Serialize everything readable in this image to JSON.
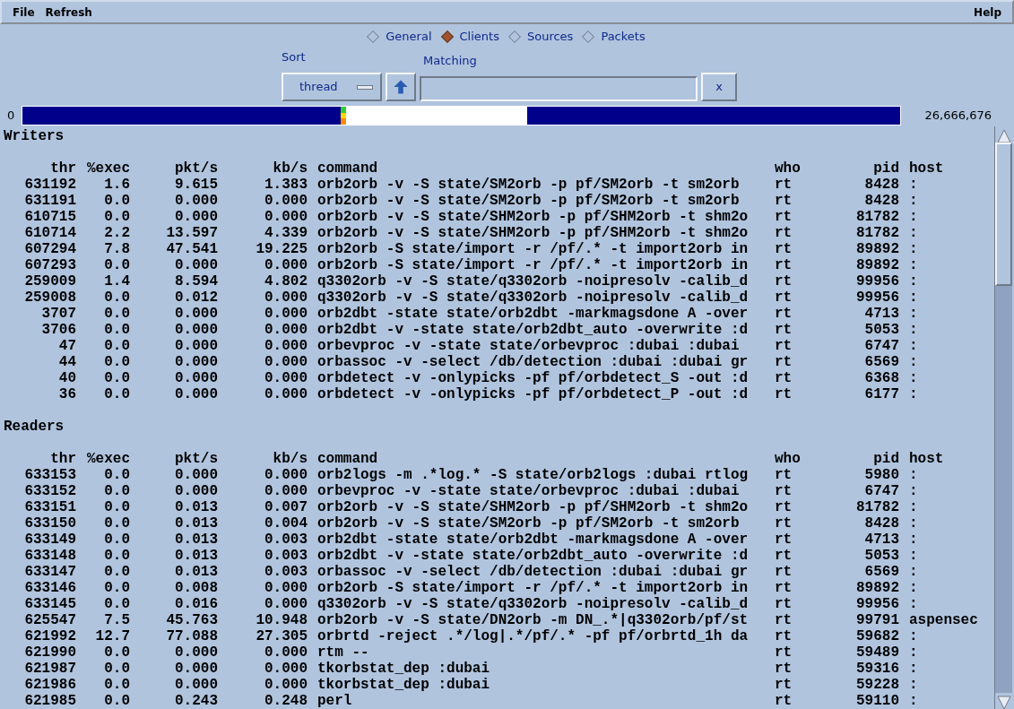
{
  "menu": [
    "File",
    "Refresh"
  ],
  "help_menu": "Help",
  "tabs": [
    {
      "label": "General",
      "selected": false
    },
    {
      "label": "Clients",
      "selected": true
    },
    {
      "label": "Sources",
      "selected": false
    },
    {
      "label": "Packets",
      "selected": false
    }
  ],
  "sort": {
    "label": "Sort",
    "value": "thread"
  },
  "matching": {
    "label": "Matching"
  },
  "clear_button": "x",
  "buffer": {
    "start_label": "0",
    "end_label": "26,666,676"
  },
  "sections": [
    {
      "title": "Writers",
      "columns": [
        "thr",
        "%exec",
        "pkt/s",
        "kb/s",
        "command",
        "who",
        "pid",
        "host"
      ],
      "rows": [
        [
          "631192",
          "1.6",
          "9.615",
          "1.383",
          "orb2orb -v -S state/SM2orb -p pf/SM2orb -t sm2orb",
          "rt",
          "8428",
          ":"
        ],
        [
          "631191",
          "0.0",
          "0.000",
          "0.000",
          "orb2orb -v -S state/SM2orb -p pf/SM2orb -t sm2orb",
          "rt",
          "8428",
          ":"
        ],
        [
          "610715",
          "0.0",
          "0.000",
          "0.000",
          "orb2orb -v -S state/SHM2orb -p pf/SHM2orb -t shm2o",
          "rt",
          "81782",
          ":"
        ],
        [
          "610714",
          "2.2",
          "13.597",
          "4.339",
          "orb2orb -v -S state/SHM2orb -p pf/SHM2orb -t shm2o",
          "rt",
          "81782",
          ":"
        ],
        [
          "607294",
          "7.8",
          "47.541",
          "19.225",
          "orb2orb -S state/import -r /pf/.* -t import2orb in",
          "rt",
          "89892",
          ":"
        ],
        [
          "607293",
          "0.0",
          "0.000",
          "0.000",
          "orb2orb -S state/import -r /pf/.* -t import2orb in",
          "rt",
          "89892",
          ":"
        ],
        [
          "259009",
          "1.4",
          "8.594",
          "4.802",
          "q3302orb -v -S state/q3302orb -noipresolv -calib_d",
          "rt",
          "99956",
          ":"
        ],
        [
          "259008",
          "0.0",
          "0.012",
          "0.000",
          "q3302orb -v -S state/q3302orb -noipresolv -calib_d",
          "rt",
          "99956",
          ":"
        ],
        [
          "3707",
          "0.0",
          "0.000",
          "0.000",
          "orb2dbt -state state/orb2dbt -markmagsdone A -over",
          "rt",
          "4713",
          ":"
        ],
        [
          "3706",
          "0.0",
          "0.000",
          "0.000",
          "orb2dbt -v -state state/orb2dbt_auto -overwrite :d",
          "rt",
          "5053",
          ":"
        ],
        [
          "47",
          "0.0",
          "0.000",
          "0.000",
          "orbevproc -v -state state/orbevproc :dubai :dubai",
          "rt",
          "6747",
          ":"
        ],
        [
          "44",
          "0.0",
          "0.000",
          "0.000",
          "orbassoc -v -select /db/detection :dubai :dubai gr",
          "rt",
          "6569",
          ":"
        ],
        [
          "40",
          "0.0",
          "0.000",
          "0.000",
          "orbdetect -v -onlypicks -pf pf/orbdetect_S -out :d",
          "rt",
          "6368",
          ":"
        ],
        [
          "36",
          "0.0",
          "0.000",
          "0.000",
          "orbdetect -v -onlypicks -pf pf/orbdetect_P -out :d",
          "rt",
          "6177",
          ":"
        ]
      ]
    },
    {
      "title": "Readers",
      "columns": [
        "thr",
        "%exec",
        "pkt/s",
        "kb/s",
        "command",
        "who",
        "pid",
        "host"
      ],
      "rows": [
        [
          "633153",
          "0.0",
          "0.000",
          "0.000",
          "orb2logs -m .*log.* -S state/orb2logs :dubai rtlog",
          "rt",
          "5980",
          ":"
        ],
        [
          "633152",
          "0.0",
          "0.000",
          "0.000",
          "orbevproc -v -state state/orbevproc :dubai :dubai",
          "rt",
          "6747",
          ":"
        ],
        [
          "633151",
          "0.0",
          "0.013",
          "0.007",
          "orb2orb -v -S state/SHM2orb -p pf/SHM2orb -t shm2o",
          "rt",
          "81782",
          ":"
        ],
        [
          "633150",
          "0.0",
          "0.013",
          "0.004",
          "orb2orb -v -S state/SM2orb -p pf/SM2orb -t sm2orb",
          "rt",
          "8428",
          ":"
        ],
        [
          "633149",
          "0.0",
          "0.013",
          "0.003",
          "orb2dbt -state state/orb2dbt -markmagsdone A -over",
          "rt",
          "4713",
          ":"
        ],
        [
          "633148",
          "0.0",
          "0.013",
          "0.003",
          "orb2dbt -v -state state/orb2dbt_auto -overwrite :d",
          "rt",
          "5053",
          ":"
        ],
        [
          "633147",
          "0.0",
          "0.013",
          "0.003",
          "orbassoc -v -select /db/detection :dubai :dubai gr",
          "rt",
          "6569",
          ":"
        ],
        [
          "633146",
          "0.0",
          "0.008",
          "0.000",
          "orb2orb -S state/import -r /pf/.* -t import2orb in",
          "rt",
          "89892",
          ":"
        ],
        [
          "633145",
          "0.0",
          "0.016",
          "0.000",
          "q3302orb -v -S state/q3302orb -noipresolv -calib_d",
          "rt",
          "99956",
          ":"
        ],
        [
          "625547",
          "7.5",
          "45.763",
          "10.948",
          "orb2orb -v -S state/DN2orb -m DN_.*|q3302orb/pf/st",
          "rt",
          "99791",
          "aspensec"
        ],
        [
          "621992",
          "12.7",
          "77.088",
          "27.305",
          "orbrtd -reject .*/log|.*/pf/.* -pf pf/orbrtd_1h da",
          "rt",
          "59682",
          ":"
        ],
        [
          "621990",
          "0.0",
          "0.000",
          "0.000",
          "rtm --",
          "rt",
          "59489",
          ":"
        ],
        [
          "621987",
          "0.0",
          "0.000",
          "0.000",
          "tkorbstat_dep :dubai",
          "rt",
          "59316",
          ":"
        ],
        [
          "621986",
          "0.0",
          "0.000",
          "0.000",
          "tkorbstat_dep :dubai",
          "rt",
          "59228",
          ":"
        ],
        [
          "621985",
          "0.0",
          "0.243",
          "0.248",
          "perl",
          "rt",
          "59110",
          ":"
        ]
      ]
    }
  ]
}
